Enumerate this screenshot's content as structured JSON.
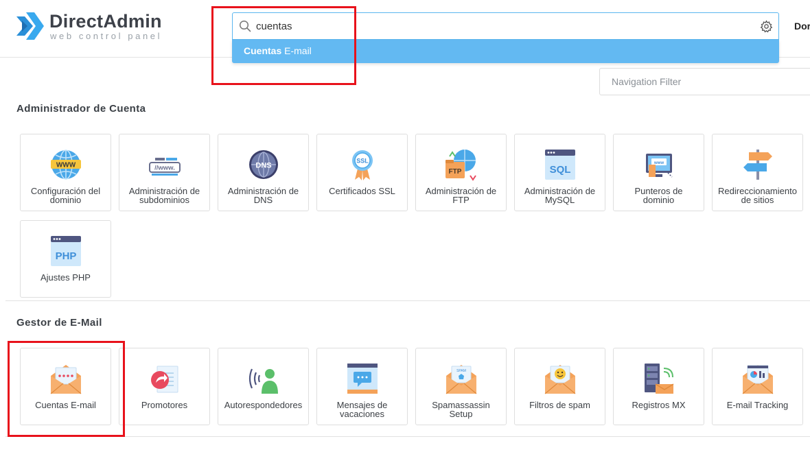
{
  "logo": {
    "name": "DirectAdmin",
    "tagline": "web control panel"
  },
  "header": {
    "right_text": "Dor"
  },
  "search": {
    "value": "cuentas",
    "suggestion_bold": "Cuentas",
    "suggestion_rest": " E-mail"
  },
  "nav_filter": {
    "placeholder": "Navigation Filter"
  },
  "sections": [
    {
      "title": "Administrador de Cuenta",
      "tiles": [
        {
          "label": "Configuración del\ndominio",
          "icon": "www-globe-icon"
        },
        {
          "label": "Administración de\nsubdominios",
          "icon": "subdomain-icon"
        },
        {
          "label": "Administración de\nDNS",
          "icon": "dns-globe-icon"
        },
        {
          "label": "Certificados SSL",
          "icon": "ssl-badge-icon"
        },
        {
          "label": "Administración de\nFTP",
          "icon": "ftp-folder-icon"
        },
        {
          "label": "Administración de\nMySQL",
          "icon": "sql-database-icon"
        },
        {
          "label": "Punteros de\ndominio",
          "icon": "domain-pointer-icon"
        },
        {
          "label": "Redireccionamiento\nde sitios",
          "icon": "signpost-icon"
        },
        {
          "label": "Ajustes PHP",
          "icon": "php-window-icon"
        }
      ]
    },
    {
      "title": "Gestor de E-Mail",
      "tiles": [
        {
          "label": "Cuentas E-mail",
          "icon": "email-envelope-icon"
        },
        {
          "label": "Promotores",
          "icon": "forwarder-icon"
        },
        {
          "label": "Autorespondedores",
          "icon": "autoresponder-icon"
        },
        {
          "label": "Mensajes de\nvacaciones",
          "icon": "vacation-message-icon"
        },
        {
          "label": "Spamassassin\nSetup",
          "icon": "spam-envelope-icon"
        },
        {
          "label": "Filtros de spam",
          "icon": "spam-filter-icon"
        },
        {
          "label": "Registros MX",
          "icon": "mx-server-icon"
        },
        {
          "label": "E-mail Tracking",
          "icon": "email-tracking-icon"
        }
      ]
    }
  ],
  "colors": {
    "accent": "#63b9f2",
    "highlight": "#e8121b",
    "orange": "#f4a259",
    "blue": "#3f8fd9"
  }
}
